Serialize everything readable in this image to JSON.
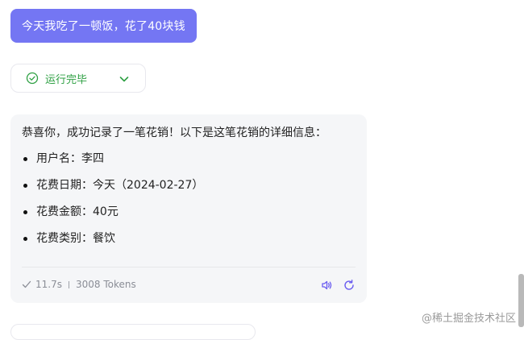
{
  "user_message": {
    "text": "今天我吃了一顿饭，花了40块钱"
  },
  "status": {
    "label": "运行完毕",
    "icon": "check-circle-icon",
    "color": "#2ea043"
  },
  "answer": {
    "intro": "恭喜你，成功记录了一笔花销！以下是这笔花销的详细信息：",
    "items": [
      "用户名：李四",
      "花费日期：今天（2024-02-27）",
      "花费金额：40元",
      "花费类别：餐饮"
    ],
    "meta": {
      "duration": "11.7s",
      "tokens": "3008 Tokens"
    },
    "actions": [
      "speaker-icon",
      "refresh-icon"
    ]
  },
  "watermark": "@稀土掘金技术社区",
  "colors": {
    "accent": "#7476f3",
    "success": "#2ea043",
    "card_bg": "#f5f6f8"
  }
}
